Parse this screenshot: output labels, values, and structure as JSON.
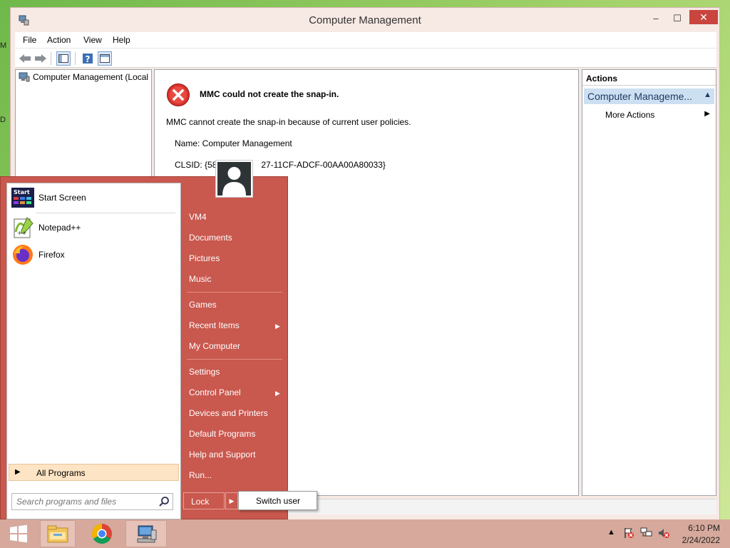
{
  "window": {
    "title": "Computer Management",
    "controls": {
      "minimize": "–",
      "maximize": "☐",
      "close": "✕"
    }
  },
  "menubar": {
    "items": [
      "File",
      "Action",
      "View",
      "Help"
    ]
  },
  "tree": {
    "root": "Computer Management (Local"
  },
  "error": {
    "title": "MMC could not create the snap-in.",
    "message": "MMC cannot create the snap-in because of current user policies.",
    "name": "Name: Computer Management",
    "clsid": "CLSID: {58",
    "clsid_tail": "27-11CF-ADCF-00AA00A80033}"
  },
  "actions": {
    "header": "Actions",
    "group": "Computer Manageme...",
    "more": "More Actions"
  },
  "desktop_fragments": {
    "top": "M",
    "middle": "D"
  },
  "start_menu": {
    "pinned": [
      "Start Screen",
      "Notepad++",
      "Firefox"
    ],
    "start_screen_icon_text": "Start",
    "all_programs": "All Programs",
    "search_placeholder": "Search programs and files",
    "right_links": {
      "user": "VM4",
      "documents": "Documents",
      "pictures": "Pictures",
      "music": "Music",
      "games": "Games",
      "recent_items": "Recent Items",
      "my_computer": "My Computer",
      "settings": "Settings",
      "control_panel": "Control Panel",
      "devices_printers": "Devices and Printers",
      "default_programs": "Default Programs",
      "help_support": "Help and Support",
      "run": "Run..."
    },
    "lock": "Lock",
    "switch_user": "Switch user"
  },
  "clock": {
    "time": "6:10 PM",
    "date": "2/24/2022"
  },
  "colors": {
    "start_menu_bg": "#c9584e",
    "taskbar_bg": "#d6a99c",
    "window_frame": "#f7e9e4",
    "close_btn": "#c9453d"
  }
}
